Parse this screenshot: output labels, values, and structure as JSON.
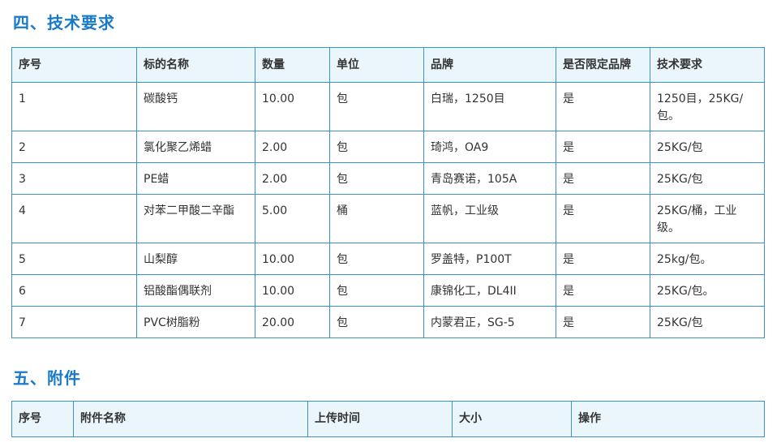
{
  "section4": {
    "title": "四、技术要求",
    "headers": [
      "序号",
      "标的名称",
      "数量",
      "单位",
      "品牌",
      "是否限定品牌",
      "技术要求"
    ],
    "rows": [
      [
        "1",
        "碳酸钙",
        "10.00",
        "包",
        "白瑞，1250目",
        "是",
        "1250目，25KG/包。"
      ],
      [
        "2",
        "氯化聚乙烯蜡",
        "2.00",
        "包",
        "琦鸿，OA9",
        "是",
        "25KG/包"
      ],
      [
        "3",
        "PE蜡",
        "2.00",
        "包",
        "青岛赛诺，105A",
        "是",
        "25KG/包"
      ],
      [
        "4",
        "对苯二甲酸二辛酯",
        "5.00",
        "桶",
        "蓝帆，工业级",
        "是",
        "25KG/桶，工业级。"
      ],
      [
        "5",
        "山梨醇",
        "10.00",
        "包",
        "罗盖特，P100T",
        "是",
        "25kg/包。"
      ],
      [
        "6",
        "铝酸酯偶联剂",
        "10.00",
        "包",
        "康锦化工，DL4II",
        "是",
        "25KG/包。"
      ],
      [
        "7",
        "PVC树脂粉",
        "20.00",
        "包",
        "内蒙君正，SG-5",
        "是",
        "25KG/包"
      ]
    ]
  },
  "section5": {
    "title": "五、附件",
    "headers": [
      "序号",
      "附件名称",
      "上传时间",
      "大小",
      "操作"
    ]
  }
}
